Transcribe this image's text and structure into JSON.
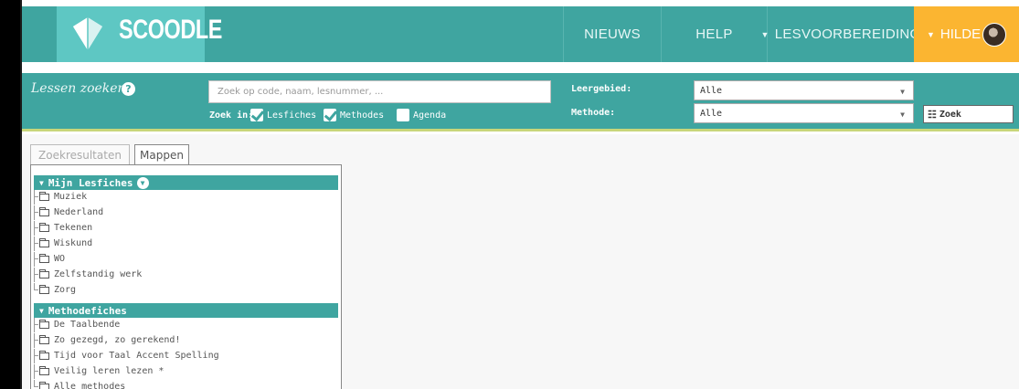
{
  "app": {
    "logo_text": "SCOODLE"
  },
  "nav": {
    "items": [
      {
        "label": "NIEUWS"
      },
      {
        "label": "HELP"
      },
      {
        "label": "LESVOORBEREIDING"
      }
    ],
    "user_name": "HILDE"
  },
  "search": {
    "title": "Lessen zoeken",
    "placeholder": "Zoek op code, naam, lesnummer, ...",
    "zoek_in_label": "Zoek in:",
    "options": [
      {
        "label": "Lesfiches",
        "checked": true
      },
      {
        "label": "Methodes",
        "checked": true
      },
      {
        "label": "Agenda",
        "checked": false
      }
    ],
    "leergebied_label": "Leergebied:",
    "leergebied_value": "Alle",
    "methode_label": "Methode:",
    "methode_value": "Alle",
    "button_label": "Zoek"
  },
  "tabs": [
    {
      "label": "Zoekresultaten",
      "active": false
    },
    {
      "label": "Mappen",
      "active": true
    }
  ],
  "sections": [
    {
      "title": "Mijn Lesfiches",
      "items": [
        "Muziek",
        "Nederland",
        "Tekenen",
        "Wiskund",
        "WO",
        "Zelfstandig werk",
        "Zorg"
      ]
    },
    {
      "title": "Methodefiches",
      "items": [
        "De Taalbende",
        "Zo gezegd, zo gerekend!",
        "Tijd voor Taal Accent Spelling",
        "Veilig leren lezen *",
        "Alle methodes"
      ]
    }
  ],
  "colors": {
    "teal": "#3fa5a0",
    "orange": "#fbb531",
    "logo_teal": "#5ec7c3"
  }
}
